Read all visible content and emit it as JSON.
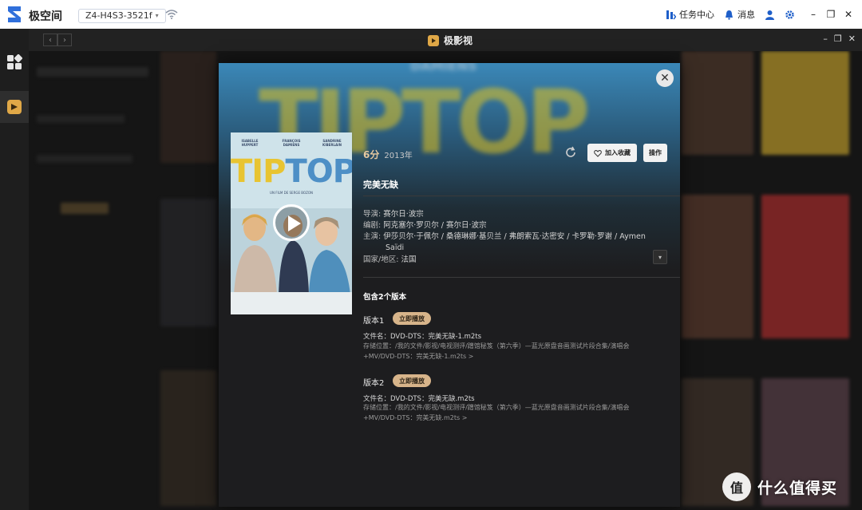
{
  "system_bar": {
    "brand": "极空间",
    "device_name": "Z4-H4S3-3521f",
    "device_caret": "▾",
    "task_center": "任务中心",
    "messages": "消息",
    "window_min": "–",
    "window_max": "❐",
    "window_close": "✕",
    "colors": {
      "brand_blue": "#2f6fdb"
    }
  },
  "app_bar": {
    "title": "极影视",
    "back": "‹",
    "forward": "›",
    "min": "–",
    "max": "❐",
    "close": "✕"
  },
  "rail": {
    "items": [
      {
        "icon": "apps-grid-icon",
        "active": false
      },
      {
        "icon": "video-app-icon",
        "active": true
      }
    ]
  },
  "modal": {
    "close": "✕",
    "hero_words": [
      "DAMIENS",
      "TIPTOP"
    ],
    "poster": {
      "cast_left": "ISABELLE HUPPERT",
      "cast_center": "FRANÇOIS DAMIENS",
      "cast_right": "SANDRINE KIBERLAIN",
      "title_tip": "TIP",
      "title_top": "TOP",
      "credit": "UN FILM DE SERGE BOZON"
    },
    "score": "6分",
    "year": "2013年",
    "favorite_label": "加入收藏",
    "operate_label": "操作",
    "title": "完美无缺",
    "director_label": "导演:",
    "director": "赛尔日·波宗",
    "writer_label": "编剧:",
    "writer": "阿克塞尔·罗贝尔 / 赛尔日·波宗",
    "cast_label": "主演:",
    "cast_line1": "伊莎贝尔·于佩尔 / 桑德琳娜·基贝兰 / 弗朗索瓦·达密安 / 卡罗勒·罗谢 / Aymen",
    "cast_line2": "Saïdi",
    "country_label": "国家/地区:",
    "country": "法国",
    "expand": "▾",
    "versions_heading": "包含2个版本",
    "versions": [
      {
        "name": "版本1",
        "play_label": "立即播放",
        "file": "文件名：DVD-DTS：完美无缺-1.m2ts",
        "path_line1": "存储位置：/我的文件/影视/电视测评/蹭馆秘笈（第六季）—蓝光原盘音画测试片段合集/演唱会",
        "path_line2": "+MV/DVD-DTS：完美无缺-1.m2ts >"
      },
      {
        "name": "版本2",
        "play_label": "立即播放",
        "file": "文件名：DVD-DTS：完美无缺.m2ts",
        "path_line1": "存储位置：/我的文件/影视/电视测评/蹭馆秘笈（第六季）—蓝光原盘音画测试片段合集/演唱会",
        "path_line2": "+MV/DVD-DTS：完美无缺.m2ts >"
      }
    ],
    "colors": {
      "accent_gold": "#d7b48a",
      "score_gold": "#e6c9a0"
    }
  },
  "watermark": {
    "glyph": "值",
    "text": "什么值得买"
  }
}
